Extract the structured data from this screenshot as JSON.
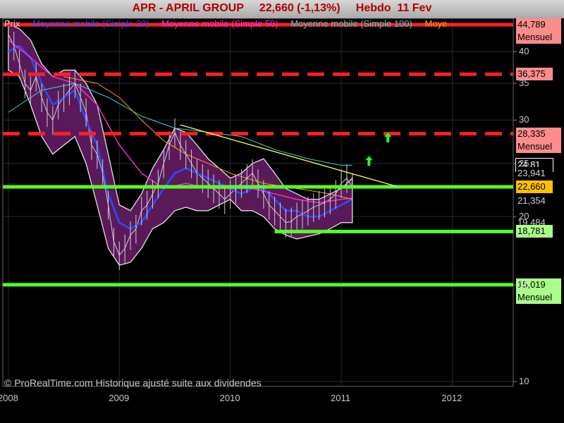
{
  "title": "APR - APRIL GROUP     22,660 (-1,13%)     Hebdo  11 Fev",
  "legend": [
    {
      "label": "Prix",
      "color": "#cfcfcf"
    },
    {
      "label": "Moyenne mobile (Simple 20)",
      "color": "#2a4bff"
    },
    {
      "label": "Moyenne mobile (Simple 50)",
      "color": "#ff2fd0"
    },
    {
      "label": "Moyenne mobile (Simple 100)",
      "color": "#3fd0d0"
    },
    {
      "label": "Moye",
      "color": "#ff9a1f"
    }
  ],
  "footer": "© ProRealTime.com Historique ajusté suite aux dividendes",
  "price_tags": [
    {
      "id": "tag-44789",
      "value": 44.789,
      "lines": [
        "44,789",
        "Mensuel"
      ],
      "bg": "#ff8c8c"
    },
    {
      "id": "tag-36375",
      "value": 36.375,
      "lines": [
        "36,375"
      ],
      "bg": "#ff8c8c"
    },
    {
      "id": "tag-28335",
      "value": 28.335,
      "lines": [
        "28,335",
        "Mensuel"
      ],
      "bg": "#ff8c8c"
    },
    {
      "id": "tag-2481",
      "value": 24.81,
      "lines": [
        "24,81"
      ],
      "bg": "#000000",
      "fg": "#ffffff",
      "border": "#ffffff"
    },
    {
      "id": "tag-23941",
      "value": 23.941,
      "lines": [
        "23,941"
      ],
      "bg": "#000000",
      "fg": "#cfcfcf"
    },
    {
      "id": "tag-22660",
      "value": 22.66,
      "lines": [
        "22,660"
      ],
      "bg": "#ffc000"
    },
    {
      "id": "tag-21354",
      "value": 21.354,
      "lines": [
        "21,354"
      ],
      "bg": "#000000",
      "fg": "#cfcfcf"
    },
    {
      "id": "tag-19484",
      "value": 19.484,
      "lines": [
        "19,484"
      ],
      "bg": "#000000",
      "fg": "#cfcfcf"
    },
    {
      "id": "tag-18781",
      "value": 18.781,
      "lines": [
        "18,781"
      ],
      "bg": "#aaff88"
    },
    {
      "id": "tag-15019",
      "value": 15.019,
      "lines": [
        "15,019",
        "Mensuel"
      ],
      "bg": "#aaff88"
    }
  ],
  "chart_data": {
    "type": "line",
    "title": "APR - APRIL GROUP",
    "timeframe": "Hebdo",
    "last_price": 22.66,
    "change_pct": -1.13,
    "yscale": "log",
    "ylim": [
      9.8,
      46
    ],
    "xlim": [
      2007.95,
      2012.55
    ],
    "y_ticks": [
      10,
      15,
      20,
      25,
      30,
      35,
      40
    ],
    "y_tick_labels": [
      "10",
      "15",
      "20",
      "25",
      "30",
      "35",
      "40"
    ],
    "x_ticks": [
      2008,
      2009,
      2010,
      2011,
      2012
    ],
    "x_tick_labels": [
      "2008",
      "2009",
      "2010",
      "2011",
      "2012"
    ],
    "series": [
      {
        "name": "Prix",
        "color": "#cfcfcf",
        "x": [
          2008.0,
          2008.05,
          2008.1,
          2008.15,
          2008.2,
          2008.25,
          2008.3,
          2008.35,
          2008.4,
          2008.45,
          2008.5,
          2008.55,
          2008.6,
          2008.65,
          2008.7,
          2008.75,
          2008.8,
          2008.85,
          2008.9,
          2008.95,
          2009.0,
          2009.05,
          2009.1,
          2009.15,
          2009.2,
          2009.25,
          2009.3,
          2009.35,
          2009.4,
          2009.45,
          2009.5,
          2009.55,
          2009.6,
          2009.65,
          2009.7,
          2009.75,
          2009.8,
          2009.85,
          2009.9,
          2009.95,
          2010.0,
          2010.05,
          2010.1,
          2010.15,
          2010.2,
          2010.25,
          2010.3,
          2010.35,
          2010.4,
          2010.45,
          2010.5,
          2010.55,
          2010.6,
          2010.65,
          2010.7,
          2010.75,
          2010.8,
          2010.85,
          2010.9,
          2010.95,
          2011.0,
          2011.05,
          2011.1
        ],
        "values": [
          43,
          41,
          38,
          35,
          34,
          36,
          33,
          31,
          30,
          32,
          33,
          34,
          35,
          33,
          31,
          27,
          26,
          24,
          21,
          18,
          17,
          17.5,
          18.5,
          19,
          20.5,
          21,
          22,
          23,
          25,
          27,
          28.5,
          27,
          26,
          25,
          24,
          23.5,
          23,
          22.5,
          22,
          21.5,
          22,
          22.5,
          23,
          23.5,
          24,
          23,
          22,
          21,
          20.5,
          20,
          19.5,
          19.6,
          20,
          20.2,
          20.5,
          20.8,
          21,
          21.2,
          21.5,
          22,
          23,
          23.5,
          22.66
        ]
      },
      {
        "name": "Moyenne mobile (Simple 20)",
        "color": "#2a4bff",
        "x": [
          2008.0,
          2008.1,
          2008.2,
          2008.3,
          2008.4,
          2008.5,
          2008.6,
          2008.7,
          2008.8,
          2008.9,
          2009.0,
          2009.1,
          2009.2,
          2009.3,
          2009.4,
          2009.5,
          2009.6,
          2009.7,
          2009.8,
          2009.9,
          2010.0,
          2010.1,
          2010.2,
          2010.3,
          2010.4,
          2010.5,
          2010.6,
          2010.7,
          2010.8,
          2010.9,
          2011.0,
          2011.1
        ],
        "values": [
          40,
          41,
          39,
          35,
          32,
          33,
          34,
          30,
          27,
          22,
          19.5,
          19,
          19.5,
          21,
          22.5,
          24,
          24.5,
          24,
          23.5,
          23,
          22.5,
          22,
          22.5,
          22.5,
          21.5,
          20.5,
          20.5,
          20,
          20,
          20.5,
          21,
          21.5
        ]
      },
      {
        "name": "Moyenne mobile (Simple 50)",
        "color": "#ff2fd0",
        "x": [
          2008.0,
          2008.2,
          2008.4,
          2008.6,
          2008.8,
          2009.0,
          2009.2,
          2009.4,
          2009.6,
          2009.8,
          2010.0,
          2010.2,
          2010.4,
          2010.6,
          2010.8,
          2011.0,
          2011.1
        ],
        "values": [
          42,
          39,
          36,
          35,
          32,
          27,
          24,
          22.5,
          23,
          22.5,
          22.5,
          22.5,
          22,
          21.5,
          21.2,
          21.5,
          21.6
        ]
      },
      {
        "name": "Moyenne mobile (Simple 100)",
        "color": "#3fd0d0",
        "x": [
          2008.0,
          2008.3,
          2008.6,
          2008.9,
          2009.2,
          2009.5,
          2009.8,
          2010.1,
          2010.4,
          2010.7,
          2011.0,
          2011.1
        ],
        "values": [
          31,
          34,
          35,
          33,
          30.5,
          29,
          28.5,
          28,
          26.5,
          25.5,
          24.8,
          24.81
        ]
      },
      {
        "name": "Moye",
        "color": "#ff9a1f",
        "x": [
          2008.5,
          2008.8,
          2009.0,
          2009.2,
          2009.4,
          2009.6,
          2009.8,
          2010.0,
          2010.3,
          2010.6,
          2010.9,
          2011.1
        ],
        "values": [
          36,
          35,
          33,
          30,
          27.5,
          26,
          25,
          24,
          23,
          22.5,
          22,
          21.5
        ]
      }
    ],
    "envelope": {
      "upper": {
        "x": [
          2008.0,
          2008.1,
          2008.2,
          2008.3,
          2008.4,
          2008.5,
          2008.6,
          2008.7,
          2008.8,
          2008.9,
          2009.0,
          2009.1,
          2009.2,
          2009.3,
          2009.4,
          2009.5,
          2009.6,
          2009.7,
          2009.8,
          2009.9,
          2010.0,
          2010.1,
          2010.2,
          2010.3,
          2010.4,
          2010.5,
          2010.6,
          2010.7,
          2010.8,
          2010.9,
          2011.0,
          2011.1
        ],
        "values": [
          45,
          44,
          42,
          38,
          36,
          37,
          37,
          35,
          32,
          26,
          21,
          20.5,
          22,
          24.5,
          26.5,
          29,
          28.5,
          27,
          25.5,
          24.5,
          23.5,
          24,
          25,
          25.5,
          24,
          22.5,
          22,
          21.5,
          21.5,
          22,
          22.5,
          23.5
        ]
      },
      "lower": {
        "x": [
          2008.0,
          2008.1,
          2008.2,
          2008.3,
          2008.4,
          2008.5,
          2008.6,
          2008.7,
          2008.8,
          2008.9,
          2009.0,
          2009.1,
          2009.2,
          2009.3,
          2009.4,
          2009.5,
          2009.6,
          2009.7,
          2009.8,
          2009.9,
          2010.0,
          2010.1,
          2010.2,
          2010.3,
          2010.4,
          2010.5,
          2010.6,
          2010.7,
          2010.8,
          2010.9,
          2011.0,
          2011.1
        ],
        "values": [
          37,
          36,
          32,
          28,
          26,
          27,
          28,
          25,
          21,
          17.5,
          16.3,
          16.5,
          17.5,
          19,
          19.5,
          20.5,
          20.8,
          20.5,
          20.5,
          21,
          21.5,
          20.5,
          20.5,
          20,
          19,
          18.5,
          18.2,
          18.4,
          18.6,
          19,
          19.5,
          19.5
        ]
      },
      "color": "#5a1a5a"
    },
    "horizontal_levels": [
      {
        "value": 44.789,
        "style": "solid",
        "color": "#ff2020",
        "x_from": 2007.95,
        "x_to": 2012.55
      },
      {
        "value": 36.375,
        "style": "dashed",
        "color": "#ff2020",
        "x_from": 2007.95,
        "x_to": 2012.55
      },
      {
        "value": 28.335,
        "style": "dashed",
        "color": "#ff2020",
        "x_from": 2007.95,
        "x_to": 2012.55
      },
      {
        "value": 22.66,
        "style": "solid",
        "color": "#55ff22",
        "x_from": 2007.95,
        "x_to": 2012.55
      },
      {
        "value": 18.781,
        "style": "solid",
        "color": "#55ff22",
        "x_from": 2010.4,
        "x_to": 2012.55
      },
      {
        "value": 15.019,
        "style": "solid",
        "color": "#55ff22",
        "x_from": 2007.95,
        "x_to": 2012.55
      }
    ],
    "trendline": {
      "x": [
        2009.55,
        2011.5
      ],
      "values": [
        29.4,
        22.7
      ],
      "color": "#ffff40"
    },
    "arrows": [
      {
        "x": 2011.25,
        "value": 25.2,
        "color": "#22ff22"
      },
      {
        "x": 2011.42,
        "value": 27.8,
        "color": "#22ff22"
      }
    ]
  }
}
